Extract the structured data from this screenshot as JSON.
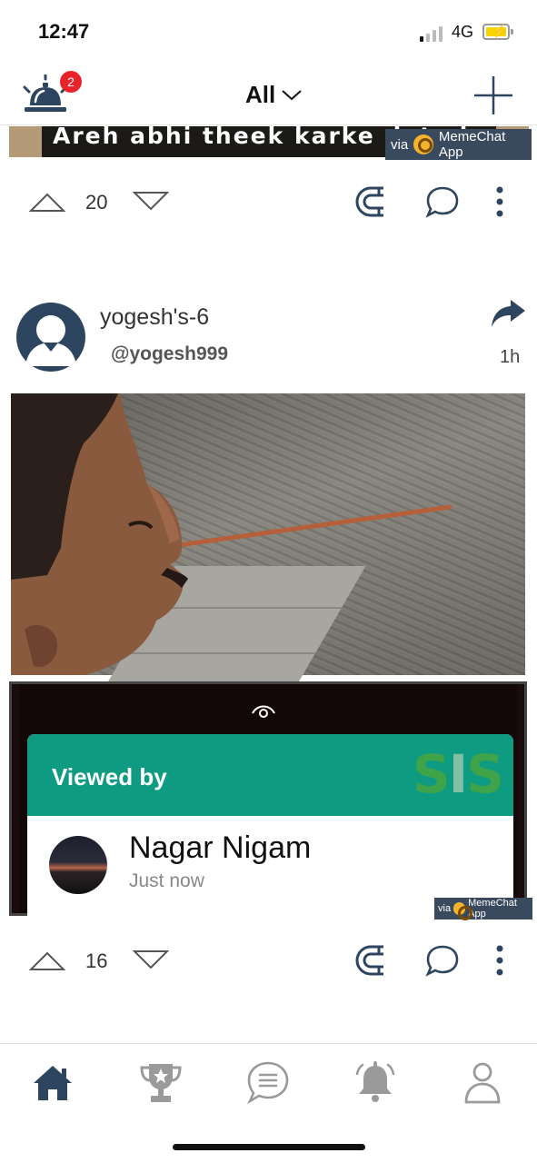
{
  "status_bar": {
    "time": "12:47",
    "network": "4G",
    "signal_level": 0.25,
    "battery_level": 0.85
  },
  "header": {
    "notifications_count": "2",
    "filter_label": "All"
  },
  "previous_post": {
    "caption": "Areh abhi theek karke deta hu",
    "watermark_via": "via",
    "watermark_app": "MemeChat App",
    "vote_count": "20"
  },
  "post": {
    "display_name": "yogesh's-6",
    "handle": "@yogesh999",
    "time_ago": "1h",
    "image": {
      "viewed_by_label": "Viewed by",
      "brand_logo": "SIS",
      "viewer_name": "Nagar Nigam",
      "viewer_time": "Just now"
    },
    "watermark_via": "via",
    "watermark_app": "MemeChat App",
    "vote_count": "16"
  },
  "icons": {
    "notifications": "bell-icon",
    "new_post": "plus-icon",
    "upvote": "triangle-up-icon",
    "downvote": "triangle-down-icon",
    "magnet": "magnet-icon",
    "comment": "chat-bubble-icon",
    "more": "vertical-dots-icon",
    "share": "share-arrow-icon"
  },
  "bottom_nav": [
    {
      "id": "home",
      "icon": "home-icon",
      "active": true
    },
    {
      "id": "leaderboard",
      "icon": "trophy-icon",
      "active": false
    },
    {
      "id": "chat",
      "icon": "chat-icon",
      "active": false
    },
    {
      "id": "alerts",
      "icon": "bell-icon",
      "active": false
    },
    {
      "id": "profile",
      "icon": "profile-icon",
      "active": false
    }
  ],
  "colors": {
    "accent": "#2e4560",
    "badge": "#e8232a",
    "viewed_by_header": "#0f9b82",
    "watermark_bg": "#3a4a5e",
    "inactive_icon": "#9a9a9a"
  }
}
